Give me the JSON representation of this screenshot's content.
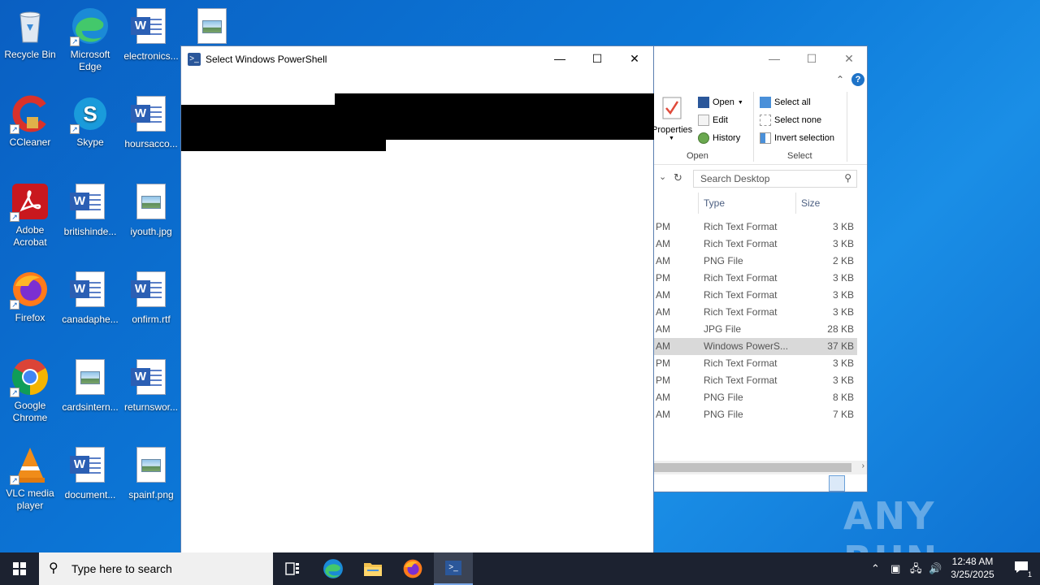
{
  "desktop": {
    "icons": [
      {
        "label": "Recycle Bin"
      },
      {
        "label": "Microsoft Edge"
      },
      {
        "label": "electronics..."
      },
      {
        "label": ""
      },
      {
        "label": "CCleaner"
      },
      {
        "label": "Skype"
      },
      {
        "label": "hoursacco..."
      },
      {
        "label": "Adobe Acrobat"
      },
      {
        "label": "britishinde..."
      },
      {
        "label": "iyouth.jpg"
      },
      {
        "label": "Firefox"
      },
      {
        "label": "canadaphe..."
      },
      {
        "label": "onfirm.rtf"
      },
      {
        "label": "Google Chrome"
      },
      {
        "label": "cardsintern..."
      },
      {
        "label": "returnswor..."
      },
      {
        "label": "VLC media player"
      },
      {
        "label": "document..."
      },
      {
        "label": "spainf.png"
      }
    ]
  },
  "powershell_window": {
    "title": "Select Windows PowerShell",
    "minimize": "—",
    "maximize": "☐",
    "close": "✕"
  },
  "explorer": {
    "minimize": "—",
    "maximize": "☐",
    "close": "✕",
    "ribbon": {
      "properties": "Properties",
      "open": "Open",
      "edit": "Edit",
      "history": "History",
      "open_group": "Open",
      "select_all": "Select all",
      "select_none": "Select none",
      "invert_selection": "Invert selection",
      "select_group": "Select"
    },
    "search_placeholder": "Search Desktop",
    "columns": {
      "type": "Type",
      "size": "Size"
    },
    "rows": [
      {
        "time": "PM",
        "type": "Rich Text Format",
        "size": "3 KB"
      },
      {
        "time": "AM",
        "type": "Rich Text Format",
        "size": "3 KB"
      },
      {
        "time": "AM",
        "type": "PNG File",
        "size": "2 KB"
      },
      {
        "time": "PM",
        "type": "Rich Text Format",
        "size": "3 KB"
      },
      {
        "time": "AM",
        "type": "Rich Text Format",
        "size": "3 KB"
      },
      {
        "time": "AM",
        "type": "Rich Text Format",
        "size": "3 KB"
      },
      {
        "time": "AM",
        "type": "JPG File",
        "size": "28 KB"
      },
      {
        "time": "AM",
        "type": "Windows PowerS...",
        "size": "37 KB"
      },
      {
        "time": "PM",
        "type": "Rich Text Format",
        "size": "3 KB"
      },
      {
        "time": "PM",
        "type": "Rich Text Format",
        "size": "3 KB"
      },
      {
        "time": "AM",
        "type": "PNG File",
        "size": "8 KB"
      },
      {
        "time": "AM",
        "type": "PNG File",
        "size": "7 KB"
      }
    ],
    "selected_row": 7
  },
  "taskbar": {
    "search_placeholder": "Type here to search",
    "time": "12:48 AM",
    "date": "3/25/2025",
    "notification_count": "1"
  },
  "watermark": "ANY RUN"
}
